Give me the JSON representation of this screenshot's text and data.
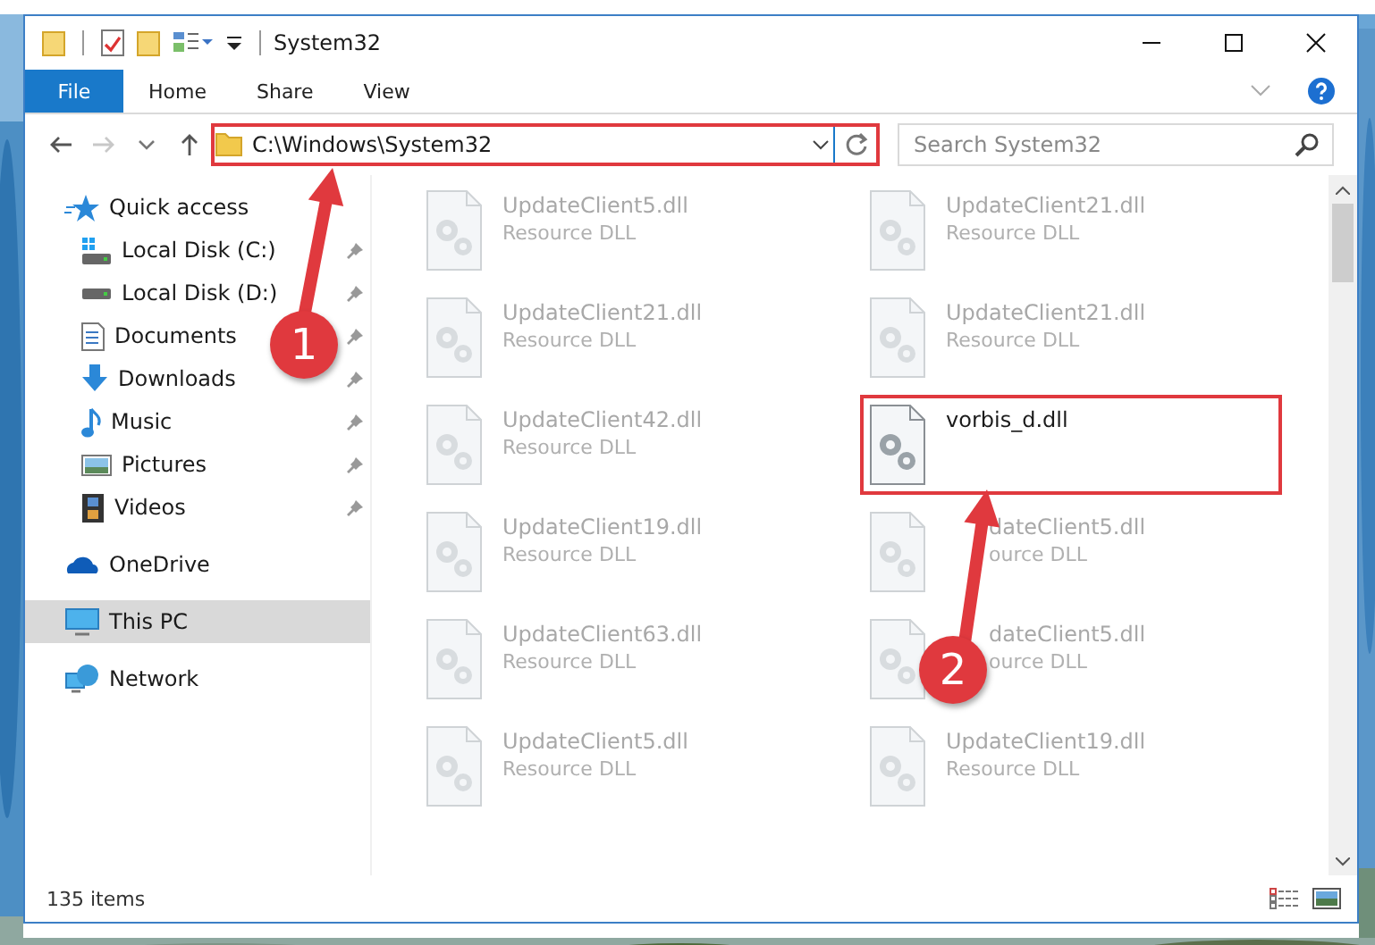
{
  "window": {
    "title": "System32"
  },
  "ribbon_tabs": [
    {
      "label": "File",
      "kind": "file"
    },
    {
      "label": "Home",
      "kind": "tab"
    },
    {
      "label": "Share",
      "kind": "tab"
    },
    {
      "label": "View",
      "kind": "tab"
    }
  ],
  "address_bar": {
    "path": "C:\\Windows\\System32",
    "highlighted": true
  },
  "search": {
    "placeholder": "Search System32"
  },
  "sidebar": {
    "items": [
      {
        "label": "Quick access",
        "kind": "star",
        "selected": false,
        "children": [
          {
            "label": "Local Disk (C:)",
            "kind": "system-drive",
            "pinned": true,
            "selected": false
          },
          {
            "label": "Local Disk (D:)",
            "kind": "drive",
            "pinned": true,
            "selected": false
          },
          {
            "label": "Documents",
            "kind": "documents",
            "pinned": true,
            "selected": false
          },
          {
            "label": "Downloads",
            "kind": "downloads",
            "pinned": true,
            "selected": false
          },
          {
            "label": "Music",
            "kind": "music",
            "pinned": true,
            "selected": false
          },
          {
            "label": "Pictures",
            "kind": "pictures",
            "pinned": true,
            "selected": false
          },
          {
            "label": "Videos",
            "kind": "videos",
            "pinned": true,
            "selected": false
          }
        ]
      },
      {
        "label": "OneDrive",
        "kind": "cloud",
        "selected": false
      },
      {
        "label": "This PC",
        "kind": "computer",
        "selected": true
      },
      {
        "label": "Network",
        "kind": "network",
        "selected": false
      }
    ]
  },
  "files": [
    {
      "name": "UpdateClient5.dll",
      "type": "Resource DLL",
      "blurred": true,
      "highlighted": false
    },
    {
      "name": "UpdateClient21.dll",
      "type": "Resource DLL",
      "blurred": true,
      "highlighted": false
    },
    {
      "name": "UpdateClient21.dll",
      "type": "Resource DLL",
      "blurred": true,
      "highlighted": false
    },
    {
      "name": "UpdateClient21.dll",
      "type": "Resource DLL",
      "blurred": true,
      "highlighted": false
    },
    {
      "name": "UpdateClient42.dll",
      "type": "Resource DLL",
      "blurred": true,
      "highlighted": false
    },
    {
      "name": "vorbis_d.dll",
      "blurred": false,
      "highlighted": true
    },
    {
      "name": "UpdateClient19.dll",
      "type": "Resource DLL",
      "blurred": true,
      "highlighted": false
    },
    {
      "name": "dateClient5.dll",
      "type": "ource DLL",
      "blurred": true,
      "highlighted": false,
      "partly_covered": true
    },
    {
      "name": "UpdateClient63.dll",
      "type": "Resource DLL",
      "blurred": true,
      "highlighted": false
    },
    {
      "name": "dateClient5.dll",
      "type": "ource DLL",
      "blurred": true,
      "highlighted": false,
      "partly_covered": true
    },
    {
      "name": "UpdateClient5.dll",
      "type": "Resource DLL",
      "blurred": true,
      "highlighted": false
    },
    {
      "name": "UpdateClient19.dll",
      "type": "Resource DLL",
      "blurred": true,
      "highlighted": false
    }
  ],
  "status_bar": {
    "item_count": "135 items"
  },
  "annotations": [
    {
      "number": "1"
    },
    {
      "number": "2"
    }
  ]
}
